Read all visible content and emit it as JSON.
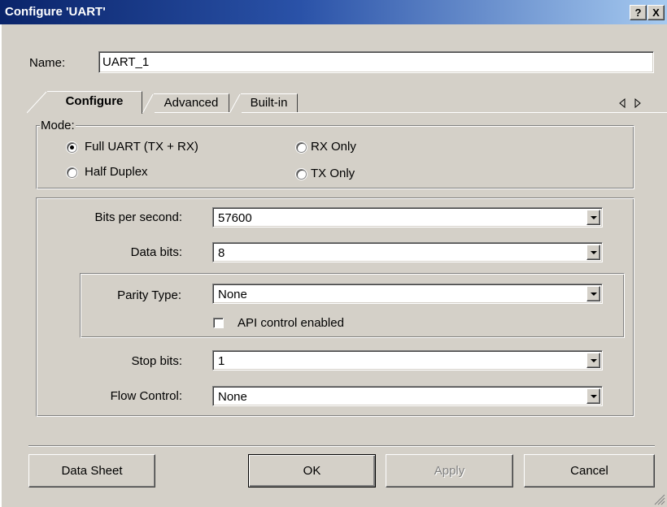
{
  "window": {
    "title": "Configure 'UART'",
    "help_button": "?",
    "close_button": "X"
  },
  "name_field": {
    "label": "Name:",
    "value": "UART_1"
  },
  "tabs": [
    {
      "label": "Configure",
      "active": true
    },
    {
      "label": "Advanced",
      "active": false
    },
    {
      "label": "Built-in",
      "active": false
    }
  ],
  "mode": {
    "legend": "Mode:",
    "options": [
      {
        "label": "Full UART (TX + RX)",
        "selected": true
      },
      {
        "label": "RX Only",
        "selected": false
      },
      {
        "label": "Half Duplex",
        "selected": false
      },
      {
        "label": "TX Only",
        "selected": false
      }
    ]
  },
  "settings": {
    "bits_per_second": {
      "label": "Bits per second:",
      "value": "57600"
    },
    "data_bits": {
      "label": "Data bits:",
      "value": "8"
    },
    "parity_type": {
      "label": "Parity Type:",
      "value": "None"
    },
    "api_control": {
      "label": "API control enabled",
      "checked": false
    },
    "stop_bits": {
      "label": "Stop bits:",
      "value": "1"
    },
    "flow_control": {
      "label": "Flow Control:",
      "value": "None"
    }
  },
  "buttons": {
    "data_sheet": "Data Sheet",
    "ok": "OK",
    "apply": "Apply",
    "cancel": "Cancel"
  },
  "icons": {
    "tab_scroll_left": "triangle-left-icon",
    "tab_scroll_right": "triangle-right-icon",
    "size_grip": "size-grip-icon"
  },
  "colors": {
    "titlebar_start": "#0a246a",
    "titlebar_end": "#a6caf0",
    "face": "#d4d0c8"
  }
}
